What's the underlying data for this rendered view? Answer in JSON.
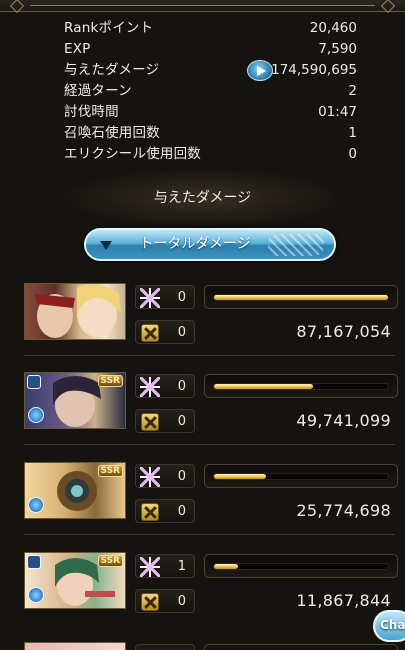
{
  "stats": [
    {
      "label": "Rankポイント",
      "value": "20,460"
    },
    {
      "label": "EXP",
      "value": "7,590"
    },
    {
      "label": "与えたダメージ",
      "value": "174,590,695"
    },
    {
      "label": "経過ターン",
      "value": "2"
    },
    {
      "label": "討伐時間",
      "value": "01:47"
    },
    {
      "label": "召喚石使用回数",
      "value": "1"
    },
    {
      "label": "エリクシール使用回数",
      "value": "0"
    }
  ],
  "section_title": "与えたダメージ",
  "sort_button_label": "トータルダメージ",
  "players": [
    {
      "star_count": "0",
      "attack_count": "0",
      "damage": "87,167,054",
      "bar_fraction": 1.0,
      "ssr": false
    },
    {
      "star_count": "0",
      "attack_count": "0",
      "damage": "49,741,099",
      "bar_fraction": 0.57,
      "ssr": true,
      "ssr_label": "SSR"
    },
    {
      "star_count": "0",
      "attack_count": "0",
      "damage": "25,774,698",
      "bar_fraction": 0.3,
      "ssr": true,
      "ssr_label": "SSR"
    },
    {
      "star_count": "1",
      "attack_count": "0",
      "damage": "11,867,844",
      "bar_fraction": 0.14,
      "ssr": true,
      "ssr_label": "SSR"
    }
  ],
  "chat_button_label": "Cha",
  "icons": {
    "detail": "play-icon",
    "star": "star-icon",
    "attack": "crossed-swords-icon",
    "sort": "triangle-down-icon"
  },
  "colors": {
    "bar_fill": "#f1c24a",
    "button_blue": "#3b93c0"
  }
}
